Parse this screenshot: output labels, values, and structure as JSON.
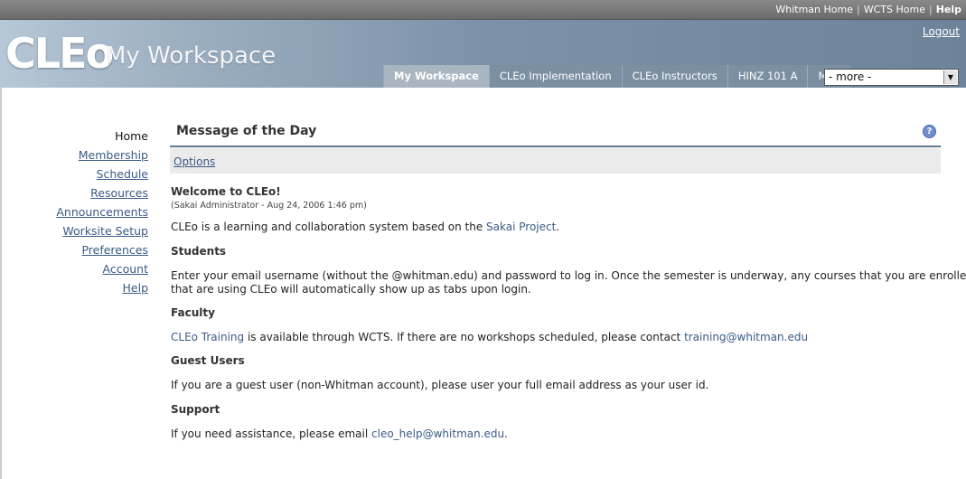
{
  "toplinks": {
    "whitman_home": "Whitman Home",
    "wcts_home": "WCTS Home",
    "help": "Help"
  },
  "header": {
    "logo": "CLEo",
    "workspace_title": "My Workspace",
    "logout": "Logout"
  },
  "tabs": [
    {
      "label": "My Workspace"
    },
    {
      "label": "CLEo Implementation"
    },
    {
      "label": "CLEo Instructors"
    },
    {
      "label": "HINZ 101 A"
    },
    {
      "label": "MDL"
    }
  ],
  "more_select": {
    "value": "- more -"
  },
  "nav": [
    {
      "label": "Home"
    },
    {
      "label": "Membership"
    },
    {
      "label": "Schedule"
    },
    {
      "label": "Resources"
    },
    {
      "label": "Announcements"
    },
    {
      "label": "Worksite Setup"
    },
    {
      "label": "Preferences"
    },
    {
      "label": "Account"
    },
    {
      "label": "Help"
    }
  ],
  "portlet": {
    "title": "Message of the Day",
    "help_icon": "?",
    "options": "Options"
  },
  "motd": {
    "welcome": "Welcome to CLEo!",
    "meta": "(Sakai Administrator - Aug 24, 2006 1:46 pm)",
    "intro_pre": "CLEo is a learning and collaboration system based on the ",
    "intro_link": "Sakai Project",
    "intro_post": ".",
    "students_h": "Students",
    "students_line1": "Enter your email username (without the @whitman.edu) and password to log in. Once the semester is underway, any courses that you are enrolled in",
    "students_line2": "that are using CLEo will automatically show up as tabs upon login.",
    "faculty_h": "Faculty",
    "faculty_link": "CLEo Training",
    "faculty_mid": " is available through WCTS. If there are no workshops scheduled, please contact ",
    "faculty_email": "training@whitman.edu",
    "guest_h": "Guest Users",
    "guest_text": "If you are a guest user (non-Whitman account), please user your full email address as your user id.",
    "support_h": "Support",
    "support_pre": "If you need assistance, please email ",
    "support_email": "cleo_help@whitman.edu",
    "support_post": "."
  }
}
